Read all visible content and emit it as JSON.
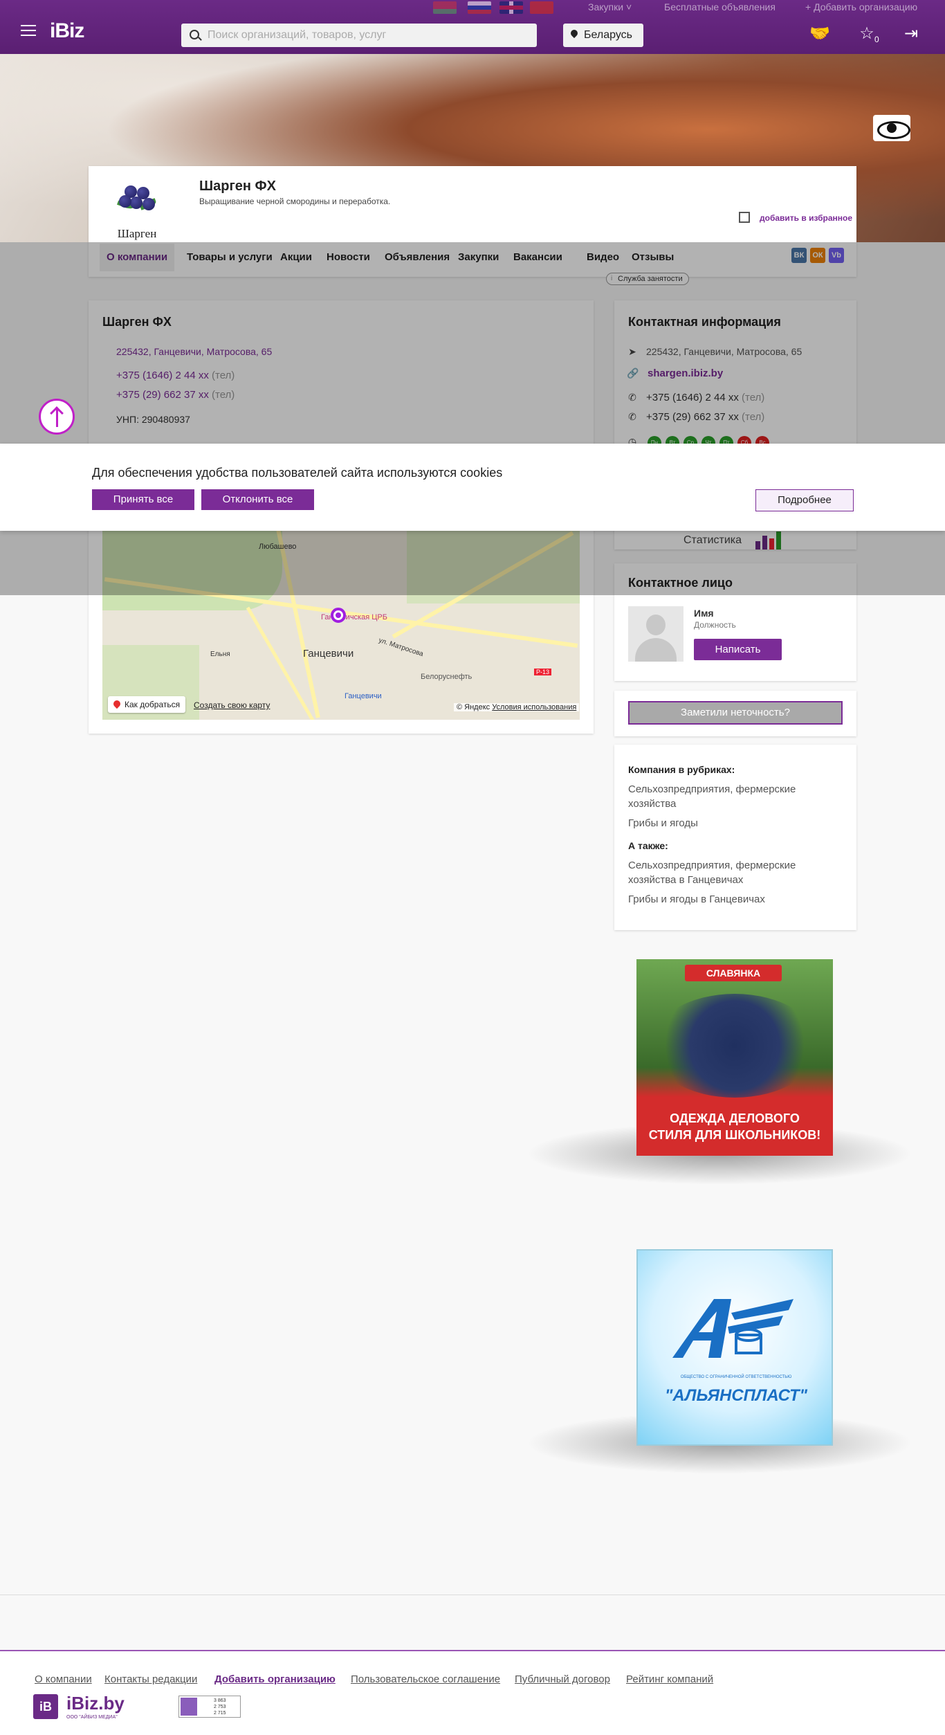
{
  "header": {
    "purchases_label": "Закупки",
    "free_ads_label": "Бесплатные объявления",
    "add_org_label": "Добавить организацию",
    "logo": "iBiz",
    "search_placeholder": "Поиск организаций, товаров, услуг",
    "region": "Беларусь",
    "favorites_count": "0",
    "languages": [
      "by",
      "ru",
      "en",
      "cn"
    ]
  },
  "company": {
    "logo_text": "Шарген",
    "name": "Шарген ФХ",
    "description": "Выращивание черной смородины и переработка.",
    "favorite_label": "добавить в избранное"
  },
  "tabs": [
    "О компании",
    "Товары и услуги",
    "Акции",
    "Новости",
    "Объявления",
    "Закупки",
    "Вакансии",
    "Видео",
    "Отзывы"
  ],
  "employment_badge": "Служба занятости",
  "social": [
    "ВК",
    "ОК",
    "Vb"
  ],
  "about": {
    "title": "Шарген ФХ",
    "address": "225432, Ганцевичи, Матросова, 65",
    "phones": [
      {
        "number": "+375 (1646) 2 44 xx",
        "tag": "(тел)"
      },
      {
        "number": "+375 (29) 662 37 xx",
        "tag": "(тел)"
      }
    ],
    "unp": "УНП: 290480937"
  },
  "map": {
    "labels": [
      "Любашево",
      "Ганцевичская ЦРБ",
      "ул. Матросова",
      "Ельня",
      "Ганцевичи",
      "Белоруснефть",
      "Ганцевичи",
      "Р-13"
    ],
    "route_button": "Как добраться",
    "create_link": "Создать свою карту",
    "copyright": "© Яндекс",
    "terms": "Условия использования"
  },
  "contact_info": {
    "title": "Контактная информация",
    "address": "225432, Ганцевичи, Матросова, 65",
    "site": "shargen.ibiz.by",
    "phones": [
      {
        "number": "+375 (1646) 2 44 xx",
        "tag": "(тел)"
      },
      {
        "number": "+375 (29) 662 37 xx",
        "tag": "(тел)"
      }
    ],
    "days": [
      "Пн",
      "Вт",
      "Ср",
      "Чт",
      "Пт",
      "Сб",
      "Вс"
    ],
    "stats_label": "Статистика"
  },
  "contact_person": {
    "title": "Контактное лицо",
    "name": "Имя",
    "position": "Должность",
    "write_button": "Написать"
  },
  "report_button": "Заметили неточность?",
  "rubrics": {
    "head1": "Компания в рубриках:",
    "items1": [
      "Сельхозпредприятия, фермерские хозяйства",
      "Грибы и ягоды"
    ],
    "head2": "А также:",
    "items2": [
      "Сельхозпредприятия, фермерские хозяйства в Ганцевичах",
      "Грибы и ягоды в Ганцевичах"
    ]
  },
  "ads": {
    "ad1_brand": "СЛАВЯНКА",
    "ad1_text_line1": "ОДЕЖДА ДЕЛОВОГО",
    "ad1_text_line2": "СТИЛЯ ДЛЯ ШКОЛЬНИКОВ!",
    "ad2_small": "ОБЩЕСТВО С ОГРАНИЧЕННОЙ ОТВЕТСТВЕННОСТЬЮ",
    "ad2_text": "\"АЛЬЯНСПЛАСТ\""
  },
  "cookie": {
    "text": "Для обеспечения удобства пользователей сайта используются cookies",
    "accept": "Принять все",
    "decline": "Отклонить все",
    "more": "Подробнее"
  },
  "footer": {
    "links": [
      "О компании",
      "Контакты редакции",
      "Добавить организацию",
      "Пользовательское соглашение",
      "Публичный договор",
      "Рейтинг компаний"
    ],
    "logo_box": "iB",
    "logo_text": "iBiz.by",
    "logo_sub": "ООО \"АЙБИЗ МЕДИА\"",
    "counter": [
      "3 863",
      "2 753",
      "2 715"
    ]
  },
  "colors": {
    "brand": "#6a2a86",
    "accent_link": "#7b2c97"
  }
}
